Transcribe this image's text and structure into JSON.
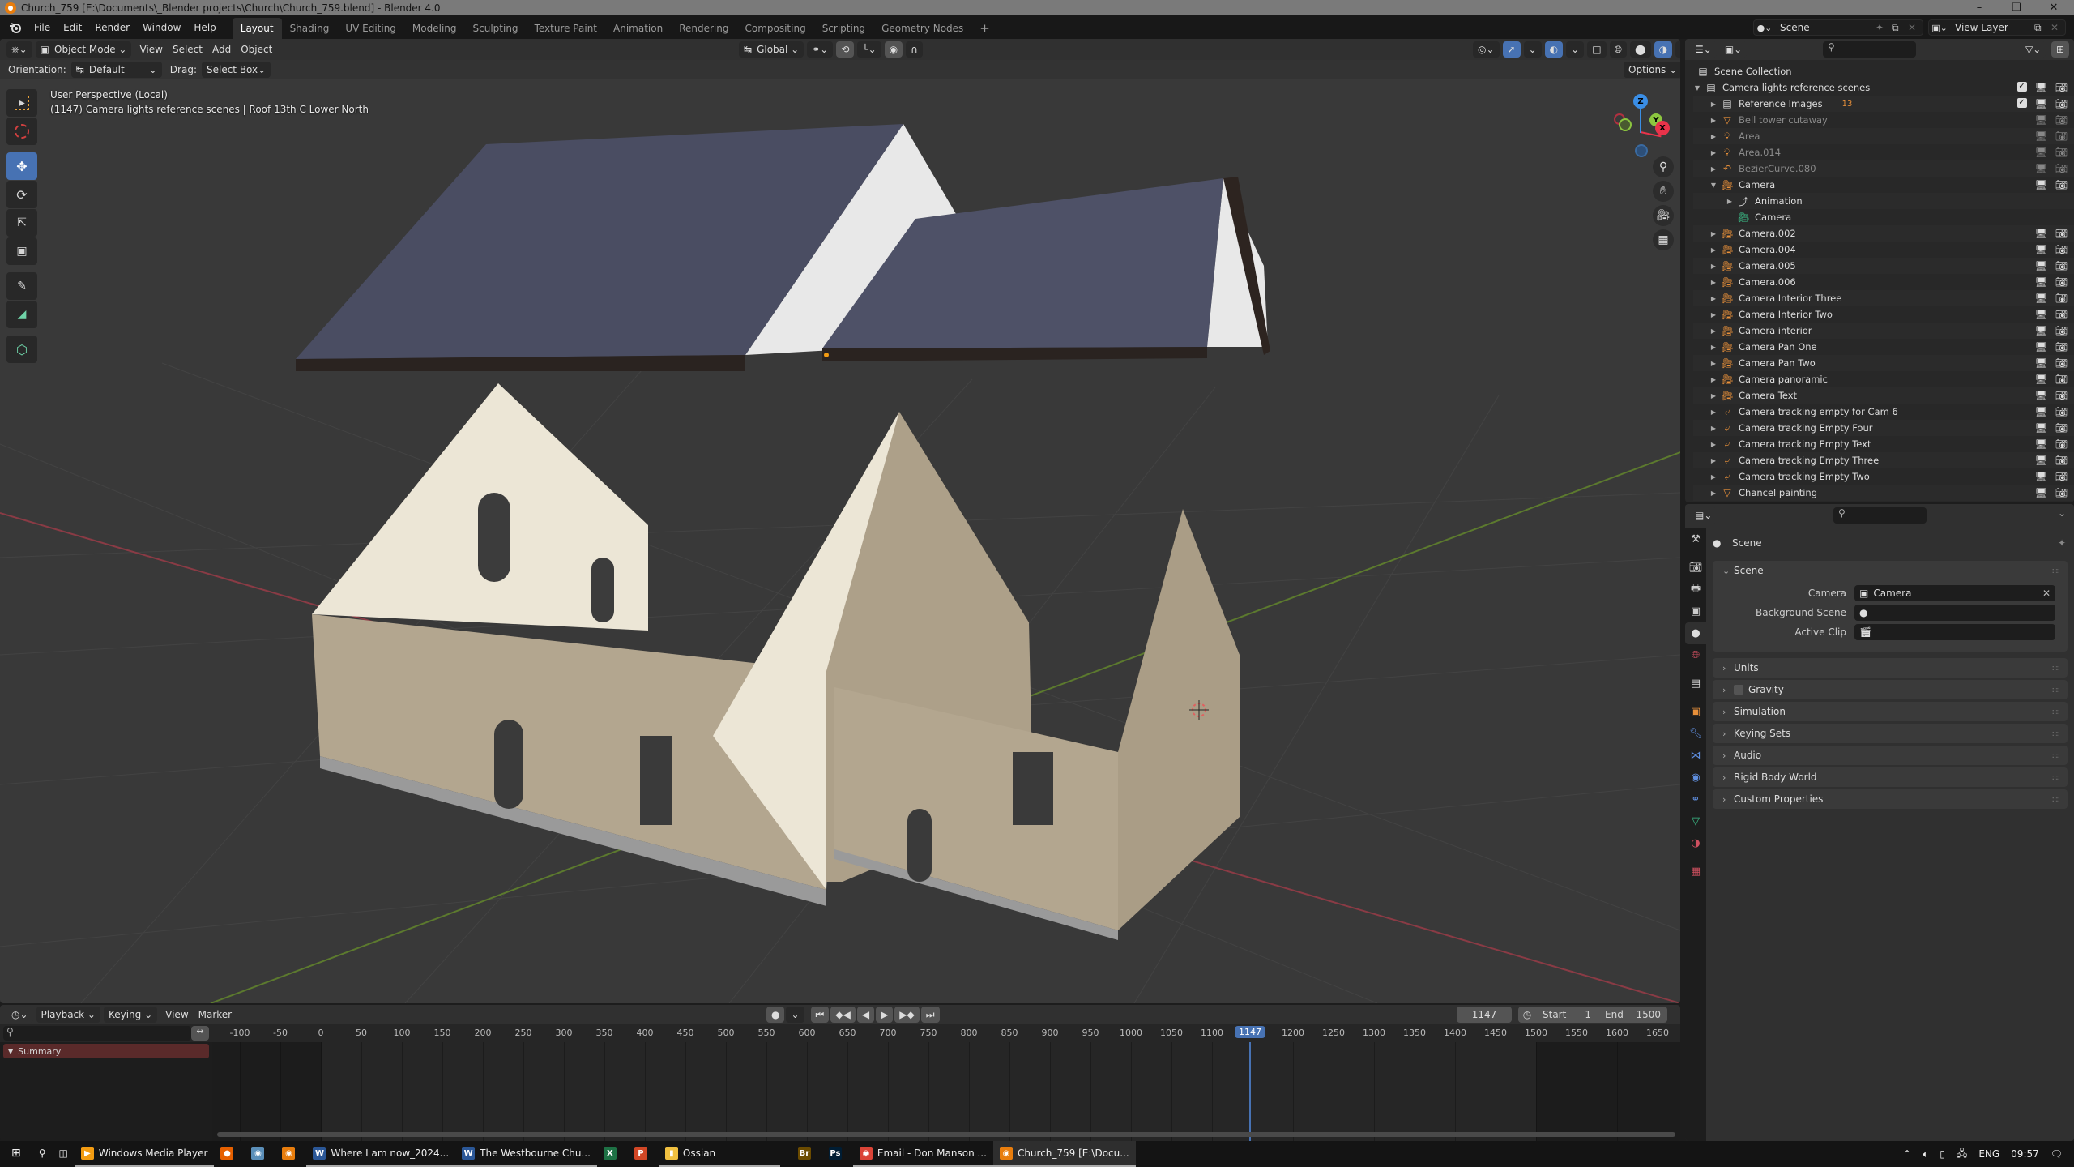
{
  "window": {
    "title": "Church_759 [E:\\Documents\\_Blender projects\\Church\\Church_759.blend] - Blender 4.0",
    "controls": [
      "minimize",
      "restore",
      "close"
    ]
  },
  "menubar": {
    "menus": [
      "File",
      "Edit",
      "Render",
      "Window",
      "Help"
    ],
    "workspaces": [
      "Layout",
      "Shading",
      "UV Editing",
      "Modeling",
      "Sculpting",
      "Texture Paint",
      "Animation",
      "Rendering",
      "Compositing",
      "Scripting",
      "Geometry Nodes"
    ],
    "active_workspace": "Layout",
    "add_workspace": "+",
    "scene": "Scene",
    "view_layer": "View Layer"
  },
  "viewport": {
    "mode": "Object Mode",
    "menus": [
      "View",
      "Select",
      "Add",
      "Object"
    ],
    "transform_orientation": "Global",
    "orientation_label": "Orientation:",
    "orientation_value": "Default",
    "drag_label": "Drag:",
    "drag_value": "Select Box",
    "options_label": "Options",
    "view_name": "User Perspective (Local)",
    "context_line": "(1147) Camera lights reference scenes | Roof 13th C Lower North",
    "tools": [
      "select-box",
      "cursor",
      "move",
      "rotate",
      "scale",
      "transform",
      "annotate",
      "measure",
      "add-cube"
    ],
    "active_tool": "move",
    "gizmo_axes": {
      "z": "Z",
      "y": "Y",
      "x": "X"
    },
    "colors": {
      "accent": "#4772b3",
      "x_axis": "#e8334a",
      "y_axis": "#8cc63f",
      "z_axis": "#3a8ee6"
    }
  },
  "outliner": {
    "root": "Scene Collection",
    "items": [
      {
        "name": "Camera lights reference scenes",
        "type": "collection",
        "expanded": true,
        "depth": 0,
        "checkbox": true,
        "dim": false
      },
      {
        "name": "Reference Images",
        "type": "collection",
        "depth": 1,
        "checkbox": true,
        "badge": "13",
        "dim": false
      },
      {
        "name": "Bell tower cutaway",
        "type": "mesh",
        "depth": 1,
        "dim": true,
        "render_disabled": true
      },
      {
        "name": "Area",
        "type": "light",
        "depth": 1,
        "dim": true,
        "render_disabled": true
      },
      {
        "name": "Area.014",
        "type": "light",
        "depth": 1,
        "dim": true,
        "render_disabled": true
      },
      {
        "name": "BezierCurve.080",
        "type": "curve",
        "depth": 1,
        "dim": true,
        "render_disabled": true
      },
      {
        "name": "Camera",
        "type": "camera",
        "depth": 1,
        "expanded": true,
        "dim": false
      },
      {
        "name": "Animation",
        "type": "animation",
        "depth": 2,
        "dim": false
      },
      {
        "name": "Camera",
        "type": "camera-data",
        "depth": 2,
        "dim": false
      },
      {
        "name": "Camera.002",
        "type": "camera",
        "depth": 1,
        "dim": false
      },
      {
        "name": "Camera.004",
        "type": "camera",
        "depth": 1,
        "dim": false
      },
      {
        "name": "Camera.005",
        "type": "camera",
        "depth": 1,
        "dim": false
      },
      {
        "name": "Camera.006",
        "type": "camera",
        "depth": 1,
        "dim": false
      },
      {
        "name": "Camera Interior Three",
        "type": "camera",
        "depth": 1,
        "dim": false
      },
      {
        "name": "Camera Interior Two",
        "type": "camera",
        "depth": 1,
        "dim": false
      },
      {
        "name": "Camera interior",
        "type": "camera",
        "depth": 1,
        "dim": false
      },
      {
        "name": "Camera Pan One",
        "type": "camera",
        "depth": 1,
        "dim": false
      },
      {
        "name": "Camera Pan Two",
        "type": "camera",
        "depth": 1,
        "dim": false
      },
      {
        "name": "Camera panoramic",
        "type": "camera",
        "depth": 1,
        "dim": false
      },
      {
        "name": "Camera Text",
        "type": "camera",
        "depth": 1,
        "dim": false
      },
      {
        "name": "Camera tracking empty for Cam 6",
        "type": "empty",
        "depth": 1,
        "dim": false
      },
      {
        "name": "Camera tracking Empty Four",
        "type": "empty",
        "depth": 1,
        "dim": false
      },
      {
        "name": "Camera tracking Empty Text",
        "type": "empty",
        "depth": 1,
        "dim": false
      },
      {
        "name": "Camera tracking Empty Three",
        "type": "empty",
        "depth": 1,
        "dim": false
      },
      {
        "name": "Camera tracking Empty Two",
        "type": "empty",
        "depth": 1,
        "dim": false
      },
      {
        "name": "Chancel painting",
        "type": "mesh",
        "depth": 1,
        "dim": false
      }
    ]
  },
  "properties": {
    "context": "Scene",
    "panel_title": "Scene",
    "fields": [
      {
        "label": "Camera",
        "value": "Camera",
        "clearable": true
      },
      {
        "label": "Background Scene",
        "value": ""
      },
      {
        "label": "Active Clip",
        "value": ""
      }
    ],
    "collapsed_panels": [
      "Units",
      "Gravity",
      "Simulation",
      "Keying Sets",
      "Audio",
      "Rigid Body World",
      "Custom Properties"
    ],
    "gravity_enabled": false,
    "tabs": [
      "tool",
      "render",
      "output",
      "view-layer",
      "scene",
      "world",
      "collection",
      "object",
      "modifiers",
      "particles",
      "physics",
      "constraints",
      "data",
      "material",
      "texture"
    ],
    "active_tab": "scene"
  },
  "timeline": {
    "menus": [
      "Playback",
      "Keying",
      "View",
      "Marker"
    ],
    "current_frame": "1147",
    "start_label": "Start",
    "start": "1",
    "end_label": "End",
    "end": "1500",
    "channel": "Summary",
    "ruler": [
      "-100",
      "-50",
      "0",
      "50",
      "100",
      "150",
      "200",
      "250",
      "300",
      "350",
      "400",
      "450",
      "500",
      "550",
      "600",
      "650",
      "700",
      "750",
      "800",
      "850",
      "900",
      "950",
      "1000",
      "1050",
      "1100",
      "1200",
      "1250",
      "1300",
      "1350",
      "1400",
      "1450",
      "1500",
      "1550",
      "1600",
      "1650"
    ]
  },
  "taskbar": {
    "items": [
      {
        "label": "Windows Media Player",
        "icon": "wmp",
        "color": "#f39c12",
        "state": "open"
      },
      {
        "label": "",
        "icon": "firefox",
        "color": "#e66000",
        "state": "none"
      },
      {
        "label": "",
        "icon": "app",
        "color": "#5b8fb9",
        "state": "none"
      },
      {
        "label": "",
        "icon": "blender",
        "color": "#e87d0d",
        "state": "none"
      },
      {
        "label": "Where I am now_2024...",
        "icon": "word",
        "color": "#2b5797",
        "state": "open"
      },
      {
        "label": "The Westbourne Chu...",
        "icon": "word",
        "color": "#2b5797",
        "state": "open"
      },
      {
        "label": "",
        "icon": "excel",
        "color": "#1e7145",
        "state": "none"
      },
      {
        "label": "",
        "icon": "powerpoint",
        "color": "#d24726",
        "state": "none"
      },
      {
        "label": "Ossian",
        "icon": "folder",
        "color": "#f0c040",
        "state": "open"
      },
      {
        "label": "",
        "icon": "bridge",
        "color": "#6b4b00",
        "state": "none"
      },
      {
        "label": "",
        "icon": "photoshop",
        "color": "#001d34",
        "state": "none"
      },
      {
        "label": "Email - Don Manson ...",
        "icon": "chrome",
        "color": "#db4437",
        "state": "open"
      },
      {
        "label": "Church_759 [E:\\Docu...",
        "icon": "blender",
        "color": "#e87d0d",
        "state": "active"
      }
    ],
    "tray": {
      "language": "ENG",
      "time": "09:57"
    }
  }
}
